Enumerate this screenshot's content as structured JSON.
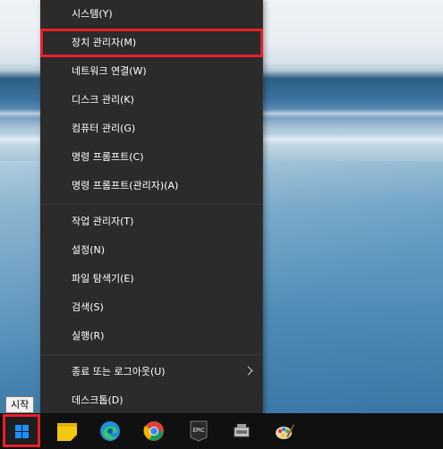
{
  "menu": {
    "items": [
      {
        "label": "시스템(Y)"
      },
      {
        "label": "장치 관리자(M)"
      },
      {
        "label": "네트워크 연결(W)"
      },
      {
        "label": "디스크 관리(K)"
      },
      {
        "label": "컴퓨터 관리(G)"
      },
      {
        "label": "명령 프롬프트(C)"
      },
      {
        "label": "명령 프롬프트(관리자)(A)"
      },
      {
        "label": "작업 관리자(T)"
      },
      {
        "label": "설정(N)"
      },
      {
        "label": "파일 탐색기(E)"
      },
      {
        "label": "검색(S)"
      },
      {
        "label": "실행(R)"
      },
      {
        "label": "종료 또는 로그아웃(U)"
      },
      {
        "label": "데스크톱(D)"
      }
    ]
  },
  "tooltip": {
    "text": "시작"
  },
  "taskbar": {
    "icons": [
      "sticky-notes-icon",
      "edge-icon",
      "chrome-icon",
      "epic-games-icon",
      "device-icon",
      "paint-icon"
    ],
    "epic_text": "EPIC"
  },
  "colors": {
    "highlight": "#e8202a",
    "menu_bg": "#2b2b2b",
    "accent": "#1a8fff"
  }
}
